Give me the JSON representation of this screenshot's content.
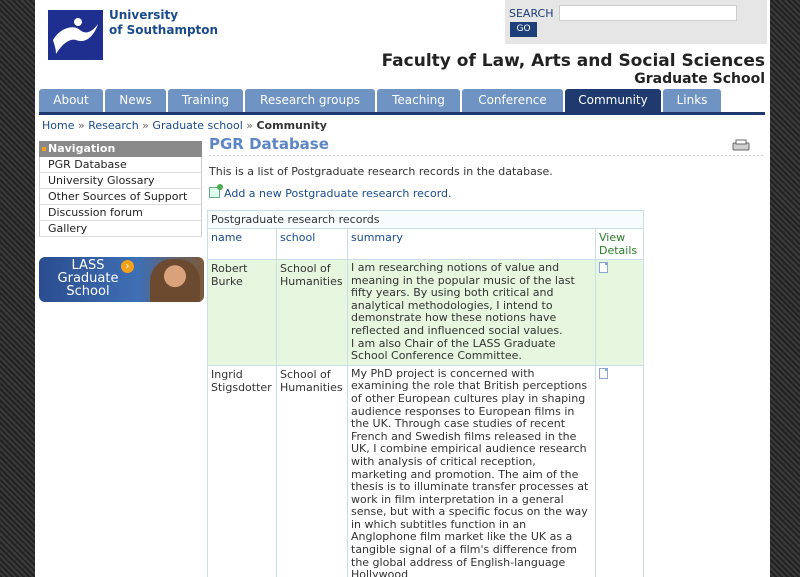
{
  "header": {
    "university_line1": "University",
    "university_line2": "of Southampton",
    "search_label": "SEARCH",
    "search_button": "GO",
    "faculty": "Faculty of Law, Arts and Social Sciences",
    "school": "Graduate School"
  },
  "tabs": [
    {
      "label": "About"
    },
    {
      "label": "News"
    },
    {
      "label": "Training"
    },
    {
      "label": "Research groups"
    },
    {
      "label": "Teaching"
    },
    {
      "label": "Conference"
    },
    {
      "label": "Community"
    },
    {
      "label": "Links"
    }
  ],
  "breadcrumb": {
    "items": [
      "Home",
      "Research",
      "Graduate school"
    ],
    "current": "Community"
  },
  "navigation": {
    "heading": "Navigation",
    "items": [
      "PGR Database",
      "University Glossary",
      "Other Sources of Support",
      "Discussion forum",
      "Gallery"
    ]
  },
  "banner": {
    "line1": "LASS",
    "line2": "Graduate",
    "line3": "School"
  },
  "main": {
    "title": "PGR Database",
    "intro": "This is a list of Postgraduate research records in the database.",
    "add_link": "Add a new Postgraduate research record."
  },
  "table": {
    "caption": "Postgraduate research records",
    "headers": {
      "name": "name",
      "school": "school",
      "summary": "summary",
      "view": "View Details"
    },
    "rows": [
      {
        "name": "Robert Burke",
        "school": "School of Humanities",
        "summary": "I am researching notions of value and meaning in the popular music of the last fifty years. By using both critical and analytical methodologies, I intend to demonstrate how these notions have reflected and influenced social values.",
        "summary2": "I am also Chair of the LASS Graduate School Conference Committee."
      },
      {
        "name": "Ingrid Stigsdotter",
        "school": "School of Humanities",
        "summary": "My PhD project is concerned with examining the role that British perceptions of other European cultures play in shaping audience responses to European films in the UK. Through case studies of recent French and Swedish films released in the UK, I combine empirical audience research with analysis of critical reception, marketing and promotion. The aim of the thesis is to illuminate transfer processes at work in film interpretation in a general sense, but with a specific focus on the way in which subtitles function in an Anglophone film market like the UK as a tangible signal of a film's difference from the global address of English-language Hollywood",
        "summary2": ""
      }
    ]
  }
}
